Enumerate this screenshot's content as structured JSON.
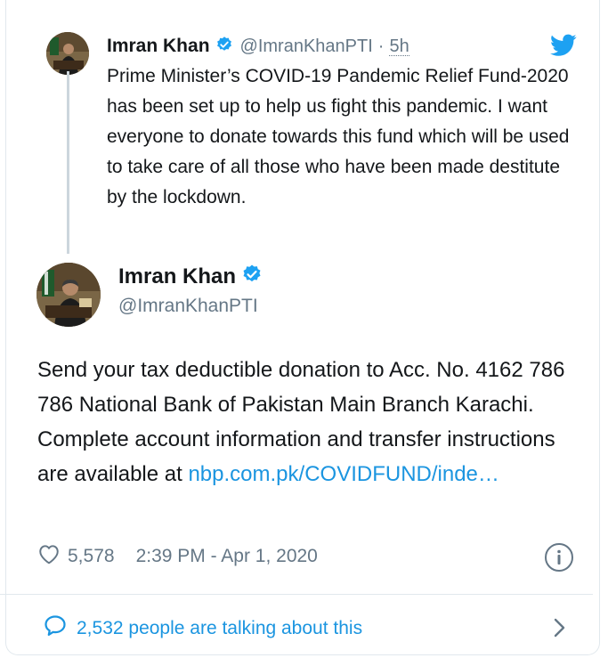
{
  "quoted_tweet": {
    "name": "Imran Khan",
    "handle": "@ImranKhanPTI",
    "separator": "·",
    "time": "5h",
    "text": "Prime Minister’s COVID-19 Pandemic Relief Fund-2020 has been set up to help us fight this pandemic. I want everyone to donate towards this fund which will be used to take care of all those who have been made destitute by the lockdown."
  },
  "main_tweet": {
    "name": "Imran Khan",
    "handle": "@ImranKhanPTI",
    "text": "Send your tax deductible donation to Acc. No. 4162 786 786 National Bank of Pakistan Main Branch Karachi. Complete account information and transfer instructions are available at ",
    "link_text": "nbp.com.pk/COVIDFUND/inde…",
    "likes": "5,578",
    "timestamp": "2:39 PM - Apr 1, 2020"
  },
  "footer": {
    "talking_text": "2,532 people are talking about this"
  },
  "icons": {
    "verified": "verified-badge-icon",
    "brand": "twitter-bird-icon",
    "like": "heart-outline-icon",
    "info": "info-circle-icon",
    "reply": "speech-bubble-icon",
    "chevron": "chevron-right-icon"
  },
  "colors": {
    "link": "#1b95e0",
    "secondary_text": "#657786",
    "primary_text": "#14171a",
    "verified": "#1da1f2",
    "border": "#e1e8ed"
  }
}
